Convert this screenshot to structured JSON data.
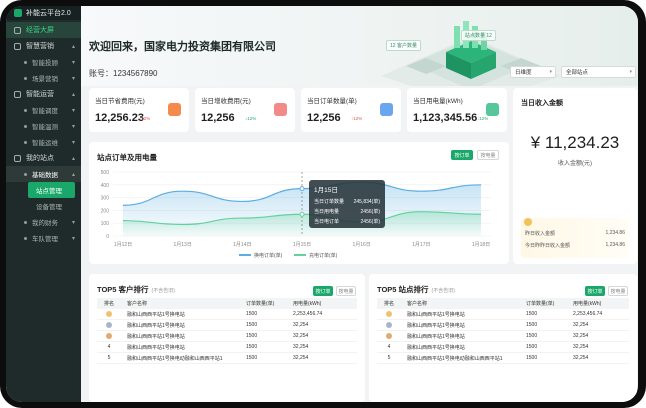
{
  "app": {
    "title": "补能云平台2.0"
  },
  "sidebar": {
    "items": [
      {
        "label": "经营大屏",
        "level": 0,
        "state": "active",
        "icon": "dashboard-icon"
      },
      {
        "label": "智慧营销",
        "level": 0,
        "state": "normal",
        "icon": "megaphone-icon",
        "caret": "▴"
      },
      {
        "label": "智能投顾",
        "level": 1,
        "state": "normal",
        "caret": "▾"
      },
      {
        "label": "场景营销",
        "level": 1,
        "state": "normal",
        "caret": "▾"
      },
      {
        "label": "智能运营",
        "level": 0,
        "state": "normal",
        "icon": "gear-icon",
        "caret": "▴"
      },
      {
        "label": "智能调度",
        "level": 1,
        "state": "normal",
        "caret": "▾"
      },
      {
        "label": "智能温测",
        "level": 1,
        "state": "normal",
        "caret": "▾"
      },
      {
        "label": "智能运维",
        "level": 1,
        "state": "normal",
        "caret": "▾"
      },
      {
        "label": "我的站点",
        "level": 0,
        "state": "normal",
        "icon": "station-icon",
        "caret": "▴"
      },
      {
        "label": "基础数据",
        "level": 1,
        "state": "highlight",
        "caret": "▴"
      },
      {
        "label": "站点管理",
        "level": 2,
        "state": "selected"
      },
      {
        "label": "设备管理",
        "level": 2,
        "state": "normal"
      },
      {
        "label": "我的财务",
        "level": 1,
        "state": "normal",
        "caret": "▾"
      },
      {
        "label": "车队管理",
        "level": 1,
        "state": "normal",
        "caret": "▾"
      }
    ]
  },
  "header": {
    "welcome": "欢迎回来，国家电力投资集团有限公司",
    "account": "账号：1234567890",
    "period_select": "日维度",
    "station_select": "全部站点",
    "tags": [
      "12 客户数量",
      "站点数量 12"
    ]
  },
  "kpis": [
    {
      "label": "当日节省费用(元)",
      "value": "12,256.23",
      "change": "12%",
      "dir": "up",
      "icon_color": "#f58a4e",
      "icon": "coin-icon"
    },
    {
      "label": "当日增收费用(元)",
      "value": "12,256",
      "change": "12%",
      "dir": "down",
      "icon_color": "#f28a8a",
      "icon": "chart-icon"
    },
    {
      "label": "当日订单数量(单)",
      "value": "12,256",
      "change": "12%",
      "dir": "up",
      "icon_color": "#6aa6f0",
      "icon": "order-icon"
    },
    {
      "label": "当日用电量(kWh)",
      "value": "1,123,345.56",
      "change": "12%",
      "dir": "down",
      "icon_color": "#56c79a",
      "icon": "energy-icon"
    }
  ],
  "revenue": {
    "title": "当日收入金额",
    "amount": "¥ 11,234.23",
    "caption": "收入金额(元)",
    "rows": [
      {
        "label": "昨日收入金额",
        "value": "1,234.86"
      },
      {
        "label": "今日昨昨日收入金额",
        "value": "1,234.86"
      }
    ]
  },
  "trend": {
    "title": "站点订单及用电量",
    "toggles": [
      "按订单",
      "按电量"
    ],
    "tooltip": {
      "title": "1月15日",
      "rows": [
        {
          "label": "当日订单数量",
          "value": "245,834(单)"
        },
        {
          "label": "当日用电量",
          "value": "2456(单)"
        },
        {
          "label": "当日电订单",
          "value": "2456(单)"
        }
      ]
    }
  },
  "chart_data": {
    "type": "area",
    "categories": [
      "1月12日",
      "1月13日",
      "1月14日",
      "1月15日",
      "1月16日",
      "1月17日",
      "1月18日"
    ],
    "ylim": [
      0,
      500
    ],
    "yticks": [
      0,
      100,
      200,
      300,
      400,
      500
    ],
    "legend_position": "bottom",
    "grid": true,
    "series": [
      {
        "name": "换电订单(单)",
        "color": "#5aaee0",
        "values": [
          240,
          350,
          270,
          370,
          420,
          350,
          400
        ]
      },
      {
        "name": "充电订单(单)",
        "color": "#63d19d",
        "values": [
          120,
          90,
          140,
          170,
          110,
          190,
          170
        ]
      }
    ]
  },
  "customer_rank": {
    "title": "TOP5 客户排行",
    "subtitle": "(不含告旧)",
    "toggles": [
      "按订单",
      "按电量"
    ],
    "columns": [
      "排名",
      "客户名称",
      "订单数量(单)",
      "用电量(kWh)"
    ],
    "rows": [
      {
        "rank": "",
        "medal": "#f1c16b",
        "name": "融和山西西平站1号换电站",
        "orders": "1500",
        "energy": "2,253,456.74"
      },
      {
        "rank": "",
        "medal": "#a9b4c9",
        "name": "融和山西西平站1号换电站",
        "orders": "1500",
        "energy": "32,254"
      },
      {
        "rank": "",
        "medal": "#e6a872",
        "name": "融和山西西平站1号换电站",
        "orders": "1500",
        "energy": "32,254"
      },
      {
        "rank": "4",
        "medal": "",
        "name": "融和山西西平站1号换电站",
        "orders": "1500",
        "energy": "32,254"
      },
      {
        "rank": "5",
        "medal": "",
        "name": "融和山西西平站1号换电动融和山西西平站1",
        "orders": "1500",
        "energy": "32,254"
      }
    ]
  },
  "station_rank": {
    "title": "TOP5 站点排行",
    "subtitle": "(不含告旧)",
    "toggles": [
      "按订单",
      "按电量"
    ],
    "columns": [
      "排名",
      "客户名称",
      "订单数量(单)",
      "用电量(kWh)"
    ],
    "rows": [
      {
        "rank": "",
        "medal": "#f1c16b",
        "name": "融和山西西平站1号换电站",
        "orders": "1500",
        "energy": "2,253,456.74"
      },
      {
        "rank": "",
        "medal": "#a9b4c9",
        "name": "融和山西西平站1号换电站",
        "orders": "1500",
        "energy": "32,254"
      },
      {
        "rank": "",
        "medal": "#e6a872",
        "name": "融和山西西平站1号换电站",
        "orders": "1500",
        "energy": "32,254"
      },
      {
        "rank": "4",
        "medal": "",
        "name": "融和山西西平站1号换电站",
        "orders": "1500",
        "energy": "32,254"
      },
      {
        "rank": "5",
        "medal": "",
        "name": "融和山西西平站1号换电动融和山西西平站1",
        "orders": "1500",
        "energy": "32,254"
      }
    ]
  }
}
